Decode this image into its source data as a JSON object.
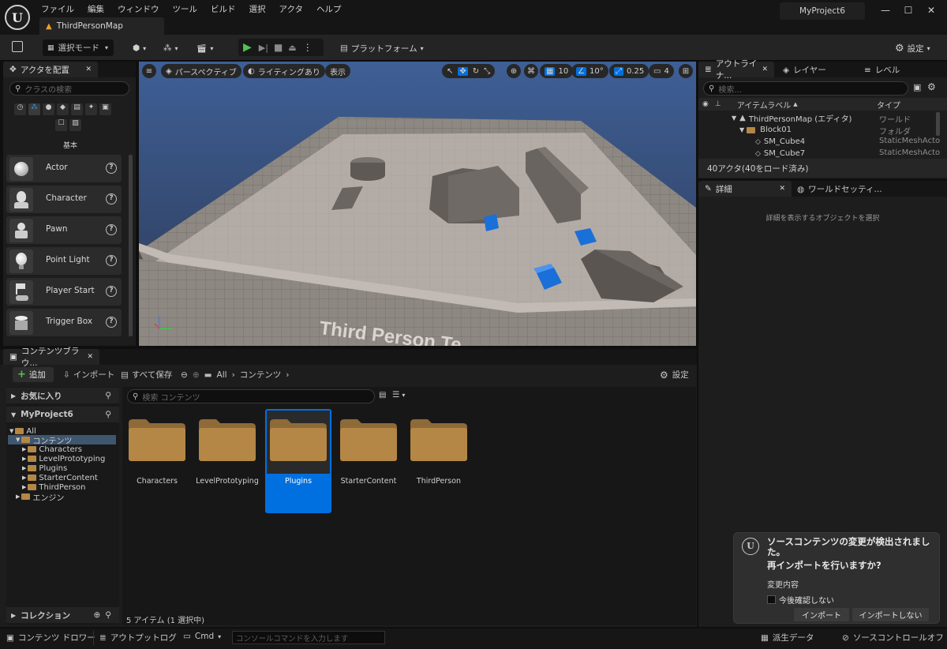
{
  "app": {
    "menu": [
      "ファイル",
      "編集",
      "ウィンドウ",
      "ツール",
      "ビルド",
      "選択",
      "アクタ",
      "ヘルプ"
    ],
    "map_tab": "ThirdPersonMap",
    "project_name": "MyProject6",
    "window_controls": [
      "minimize-icon",
      "maximize-icon",
      "close-icon"
    ]
  },
  "toolbar": {
    "mode_label": "選択モード",
    "platform_label": "プラットフォーム",
    "settings_label": "設定"
  },
  "place_actors": {
    "tab_label": "アクタを配置",
    "search_placeholder": "クラスの検索",
    "category_label": "基本",
    "items": [
      {
        "label": "Actor",
        "icon": "sphere-icon"
      },
      {
        "label": "Character",
        "icon": "character-icon"
      },
      {
        "label": "Pawn",
        "icon": "pawn-icon"
      },
      {
        "label": "Point Light",
        "icon": "light-bulb-icon"
      },
      {
        "label": "Player Start",
        "icon": "player-start-icon"
      },
      {
        "label": "Trigger Box",
        "icon": "trigger-box-icon"
      }
    ]
  },
  "viewport": {
    "perspective_label": "パースペクティブ",
    "lighting_label": "ライティングあり",
    "show_label": "表示",
    "grid_snap": "10",
    "rotation_snap": "10°",
    "scale_snap": "0.25",
    "camera_speed": "4",
    "floor_text": "Third Person Te"
  },
  "outliner": {
    "tabs": [
      "アウトライナ...",
      "レイヤー",
      "レベル"
    ],
    "search_placeholder": "検索...",
    "col_label": "アイテムラベル",
    "col_type": "タイプ",
    "rows": [
      {
        "label": "ThirdPersonMap (エディタ)",
        "type": "ワールド"
      },
      {
        "label": "Block01",
        "type": "フォルダ"
      },
      {
        "label": "SM_Cube4",
        "type": "StaticMeshActo"
      },
      {
        "label": "SM_Cube7",
        "type": "StaticMeshActo"
      }
    ],
    "status": "40アクタ(40をロード済み)"
  },
  "details": {
    "tabs": [
      "詳細",
      "ワールドセッティ..."
    ],
    "empty_message": "詳細を表示するオブジェクトを選択"
  },
  "content_browser": {
    "tab_label": "コンテンツブラウ...",
    "add_label": "追加",
    "import_label": "インポート",
    "save_all_label": "すべて保存",
    "breadcrumb": [
      "All",
      "コンテンツ"
    ],
    "settings_label": "設定",
    "favorites_label": "お気に入り",
    "project_label": "MyProject6",
    "tree": [
      {
        "label": "All",
        "depth": 0
      },
      {
        "label": "コンテンツ",
        "depth": 1
      },
      {
        "label": "Characters",
        "depth": 2
      },
      {
        "label": "LevelPrototyping",
        "depth": 2
      },
      {
        "label": "Plugins",
        "depth": 2
      },
      {
        "label": "StarterContent",
        "depth": 2
      },
      {
        "label": "ThirdPerson",
        "depth": 2
      },
      {
        "label": "エンジン",
        "depth": 1
      }
    ],
    "collection_label": "コレクション",
    "search_placeholder": "検索 コンテンツ",
    "folders": [
      "Characters",
      "LevelPrototyping",
      "Plugins",
      "StarterContent",
      "ThirdPerson"
    ],
    "selected_folder": "Plugins",
    "item_count": "5 アイテム (1 選択中)"
  },
  "bottom_bar": {
    "content_drawer": "コンテンツ ドロワー",
    "output_log": "アウトプットログ",
    "cmd_label": "Cmd",
    "console_placeholder": "コンソールコマンドを入力します",
    "derived_data": "派生データ",
    "source_control": "ソースコントロールオフ"
  },
  "toast": {
    "title": "ソースコンテンツの変更が検出されました。",
    "question": "再インポートを行いますか?",
    "changes_label": "変更内容",
    "dont_ask_label": "今後確認しない",
    "import_button": "インポート",
    "no_import_button": "インポートしない"
  },
  "colors": {
    "accent": "#0070e0",
    "play_green": "#4ec24e",
    "folder": "#b48746",
    "cube_blue": "#1a6fd8"
  }
}
